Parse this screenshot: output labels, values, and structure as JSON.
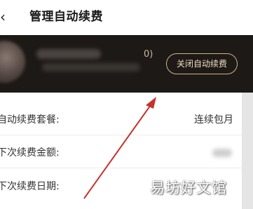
{
  "header": {
    "back_icon": "chevron-left-icon",
    "title": "管理自动续费"
  },
  "banner": {
    "count_text": "0)",
    "cancel_button_label": "关闭自动续费",
    "button_border_color": "#d2b488",
    "background_color": "#1d1916"
  },
  "details": {
    "rows": [
      {
        "label": "自动续费套餐:",
        "value": "连续包月"
      },
      {
        "label": "下次续费金额:",
        "value": ""
      },
      {
        "label": "下次续费日期:",
        "value": ""
      }
    ]
  },
  "overlay": {
    "annotation": "red-arrow-pointing-to-cancel-button",
    "arrow_color": "#c8322d",
    "watermark_text": "易坊好文馆"
  }
}
